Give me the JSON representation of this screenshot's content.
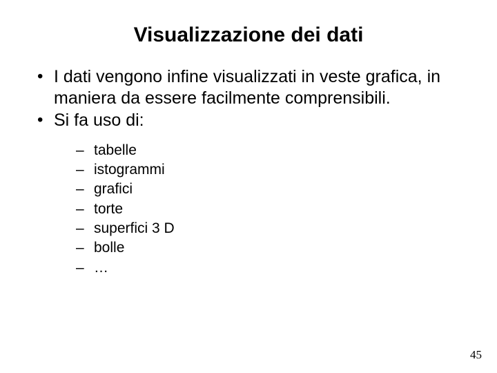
{
  "title": "Visualizzazione dei dati",
  "bullets": [
    "I dati vengono infine visualizzati in veste grafica, in maniera da essere facilmente comprensibili.",
    "Si fa uso di:"
  ],
  "subbullets": [
    "tabelle",
    "istogrammi",
    "grafici",
    "torte",
    "superfici 3 D",
    "bolle",
    "…"
  ],
  "page_number": "45"
}
